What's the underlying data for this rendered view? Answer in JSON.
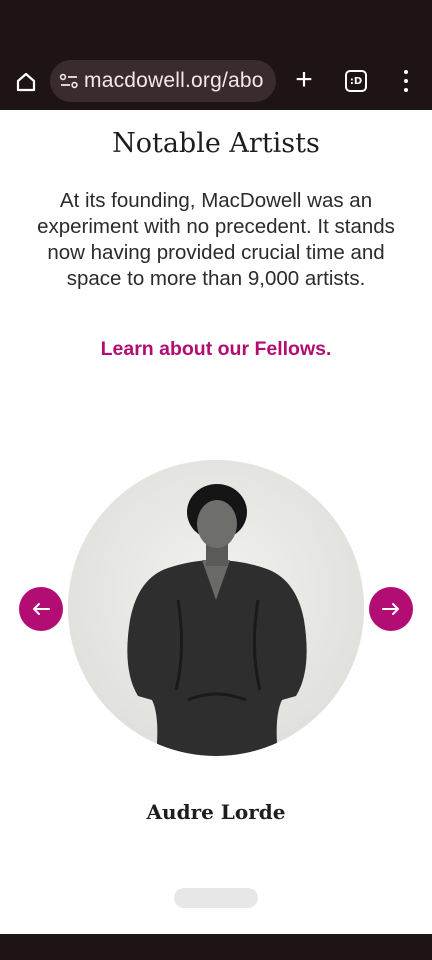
{
  "browser": {
    "url": "macdowell.org/abo",
    "tab_count_glyph": ":D",
    "new_tab_glyph": "+"
  },
  "section": {
    "title": "Notable Artists",
    "intro": "At its founding, MacDowell was an experiment with no precedent. It stands now having provided crucial time and space to more than 9,000 artists.",
    "link_label": "Learn about our Fellows."
  },
  "carousel": {
    "artist_name": "Audre Lorde",
    "prev_icon": "arrow-left-icon",
    "next_icon": "arrow-right-icon"
  },
  "colors": {
    "accent": "#b10d73",
    "chrome": "#1f1414"
  }
}
